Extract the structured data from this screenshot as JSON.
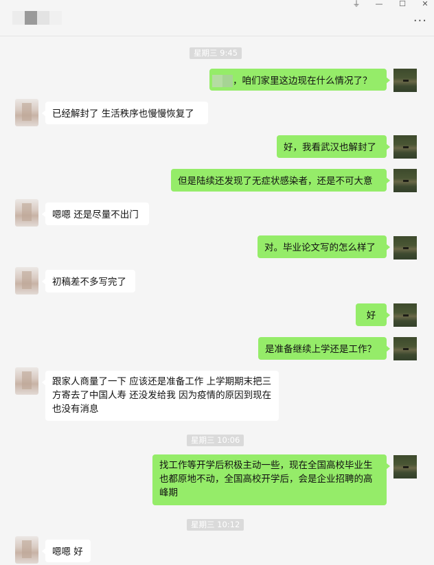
{
  "window": {
    "controls": {
      "pin": "⏚",
      "minimize": "—",
      "maximize": "☐",
      "close": "✕"
    },
    "more_icon": "···"
  },
  "chat": {
    "messages": [
      {
        "kind": "time",
        "text": "星期三 9:45"
      },
      {
        "kind": "mine",
        "text": "，咱们家里这边现在什么情况了？"
      },
      {
        "kind": "theirs",
        "text": "已经解封了  生活秩序也慢慢恢复了"
      },
      {
        "kind": "mine",
        "text": "好，我看武汉也解封了"
      },
      {
        "kind": "mine",
        "text": "但是陆续还发现了无症状感染者，还是不可大意"
      },
      {
        "kind": "theirs",
        "text": "嗯嗯  还是尽量不出门"
      },
      {
        "kind": "mine",
        "text": "对。毕业论文写的怎么样了"
      },
      {
        "kind": "theirs",
        "text": "初稿差不多写完了"
      },
      {
        "kind": "mine",
        "text": "好"
      },
      {
        "kind": "mine",
        "text": "是准备继续上学还是工作？"
      },
      {
        "kind": "theirs",
        "text": "跟家人商量了一下  应该还是准备工作  上学期期末把三方寄去了中国人寿 还没发给我 因为疫情的原因到现在也没有消息"
      },
      {
        "kind": "time",
        "text": "星期三 10:06"
      },
      {
        "kind": "mine",
        "text": "找工作等开学后积极主动一些，现在全国高校毕业生也都原地不动，全国高校开学后，会是企业招聘的高峰期"
      },
      {
        "kind": "time",
        "text": "星期三 10:12"
      },
      {
        "kind": "theirs",
        "text": "嗯嗯 好"
      }
    ]
  }
}
